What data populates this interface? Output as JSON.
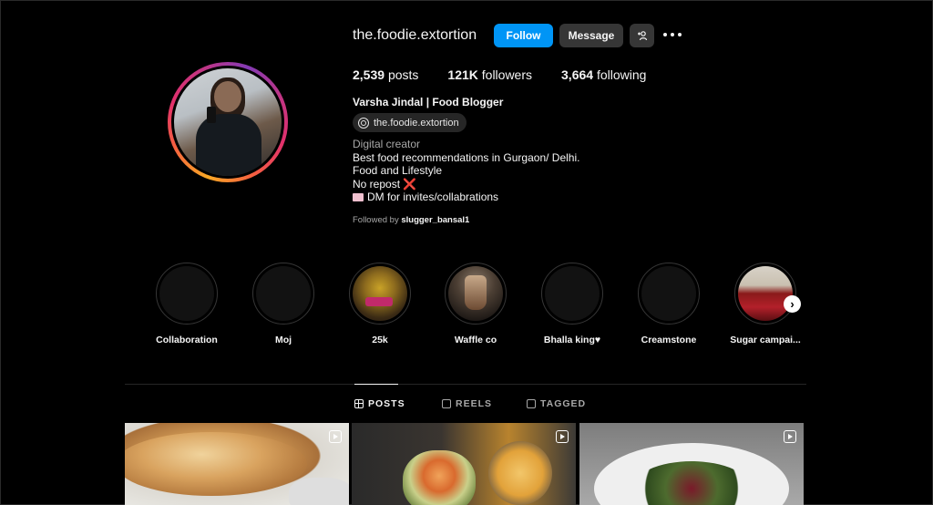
{
  "profile": {
    "username": "the.foodie.extortion",
    "follow_label": "Follow",
    "message_label": "Message",
    "add_user_icon": "add-user-icon",
    "options_icon": "more-options-icon"
  },
  "stats": {
    "posts_count": "2,539",
    "posts_label": "posts",
    "followers_count": "121K",
    "followers_label": "followers",
    "following_count": "3,664",
    "following_label": "following"
  },
  "bio": {
    "full_name": "Varsha Jindal | Food Blogger",
    "threads_handle": "the.foodie.extortion",
    "category": "Digital creator",
    "lines": [
      "Best food recommendations in Gurgaon/ Delhi.",
      "Food and Lifestyle",
      "No repost",
      "DM for invites/collabrations"
    ],
    "no_repost_emoji": "❌",
    "followed_by_prefix": "Followed by",
    "followed_by_user": "slugger_bansal1"
  },
  "highlights": [
    {
      "label": "Collaboration"
    },
    {
      "label": "Moj"
    },
    {
      "label": "25k"
    },
    {
      "label": "Waffle co"
    },
    {
      "label": "Bhalla king♥"
    },
    {
      "label": "Creamstone"
    },
    {
      "label": "Sugar campai..."
    }
  ],
  "highlights_next_icon": "›",
  "tabs": {
    "posts": "POSTS",
    "reels": "REELS",
    "tagged": "TAGGED"
  },
  "colors": {
    "follow_button": "#0095f6",
    "secondary_button": "#363636",
    "background": "#000000"
  }
}
